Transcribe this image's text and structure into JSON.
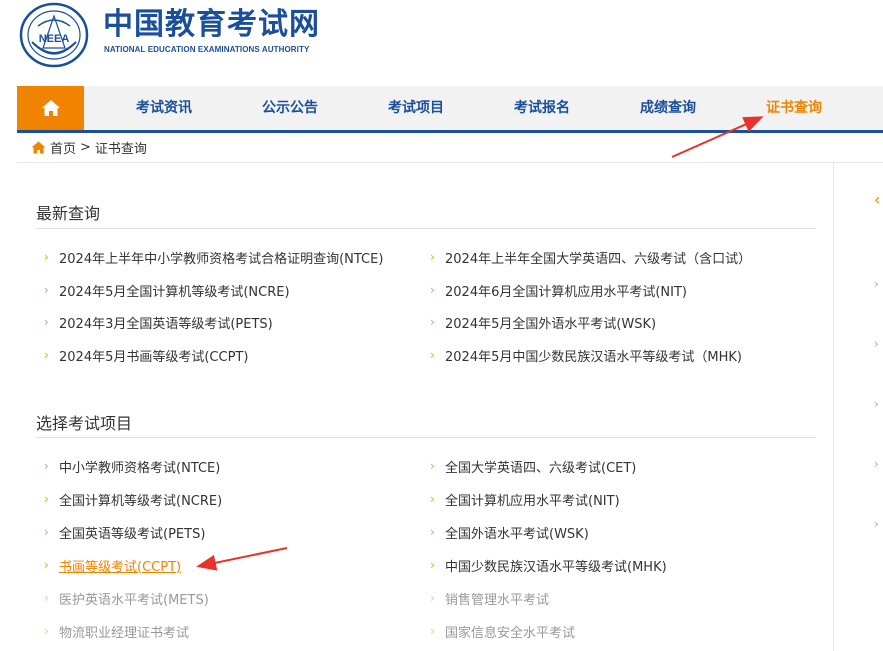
{
  "header": {
    "title": "中国教育考试网",
    "subtitle": "NATIONAL EDUCATION EXAMINATIONS AUTHORITY",
    "logo_text": "NEEA"
  },
  "nav": {
    "items": [
      {
        "label": "考试资讯"
      },
      {
        "label": "公示公告"
      },
      {
        "label": "考试项目"
      },
      {
        "label": "考试报名"
      },
      {
        "label": "成绩查询"
      },
      {
        "label": "证书查询"
      }
    ]
  },
  "breadcrumb": {
    "home": "首页",
    "separator": ">",
    "current": "证书查询"
  },
  "latest": {
    "title": "最新查询",
    "left": [
      "2024年上半年中小学教师资格考试合格证明查询(NTCE)",
      "2024年5月全国计算机等级考试(NCRE)",
      "2024年3月全国英语等级考试(PETS)",
      "2024年5月书画等级考试(CCPT)"
    ],
    "right": [
      "2024年上半年全国大学英语四、六级考试（含口试）",
      "2024年6月全国计算机应用水平考试(NIT)",
      "2024年5月全国外语水平考试(WSK)",
      "2024年5月中国少数民族汉语水平等级考试（MHK)"
    ]
  },
  "select": {
    "title": "选择考试项目",
    "left": [
      "中小学教师资格考试(NTCE)",
      "全国计算机等级考试(NCRE)",
      "全国英语等级考试(PETS)",
      "书画等级考试(CCPT)",
      "医护英语水平考试(METS)",
      "物流职业经理证书考试"
    ],
    "right": [
      "全国大学英语四、六级考试(CET)",
      "全国计算机应用水平考试(NIT)",
      "全国外语水平考试(WSK)",
      "中国少数民族汉语水平等级考试(MHK)",
      "销售管理水平考试",
      "国家信息安全水平考试"
    ]
  },
  "colors": {
    "brand_blue": "#1a4f9c",
    "accent_orange": "#f08300",
    "annotation_red": "#e8322b"
  },
  "icons": {
    "home": "home-icon",
    "chevron": "chevron-right-icon"
  }
}
